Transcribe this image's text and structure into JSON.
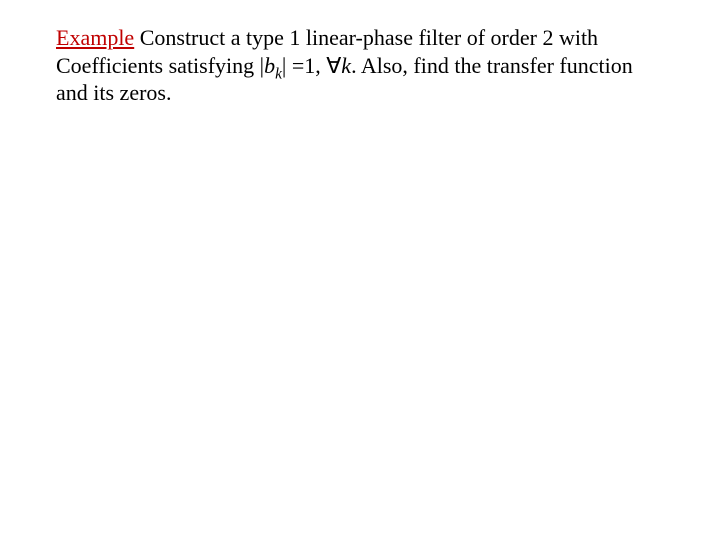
{
  "slide": {
    "heading": "Example",
    "line1_part1": " Construct a type 1 linear-phase filter of order 2 with",
    "line2_part1": "Coefficients satisfying |",
    "line2_b": "b",
    "line2_k": "k",
    "line2_part2": "| =1, ",
    "line2_forall": "∀",
    "line2_k2": "k",
    "line2_part3": ". Also, find the transfer function",
    "line3": "and its zeros."
  }
}
